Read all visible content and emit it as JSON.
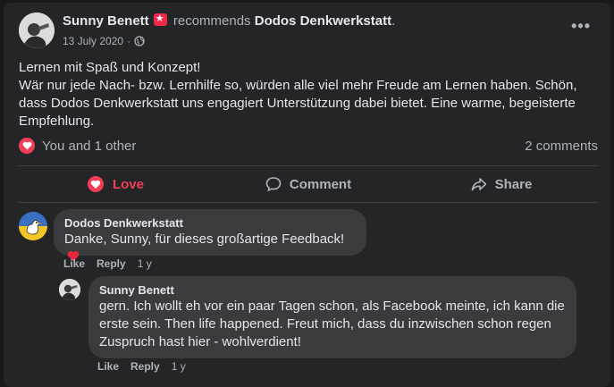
{
  "post": {
    "author": "Sunny Benett",
    "verb": "recommends",
    "page": "Dodos Denkwerkstatt",
    "period": ".",
    "date": "13 July 2020",
    "separator": "·",
    "text_lines": [
      "Lernen mit Spaß und Konzept!",
      "Wär nur jede Nach- bzw. Lernhilfe so, würden alle viel mehr Freude am Lernen haben. Schön, dass Dodos Denkwerkstatt uns engagiert Unterstützung dabei bietet. Eine warme, begeisterte Empfehlung."
    ]
  },
  "reactions": {
    "summary": "You and 1 other",
    "comments_count": "2 comments"
  },
  "actions": {
    "love": "Love",
    "comment": "Comment",
    "share": "Share"
  },
  "comments": [
    {
      "author": "Dodos Denkwerkstatt",
      "text": "Danke, Sunny, für dieses großartige Feedback!",
      "like": "Like",
      "reply": "Reply",
      "time": "1 y"
    },
    {
      "author": "Sunny Benett",
      "text": "gern. Ich wollt eh vor ein paar Tagen schon, als Facebook meinte, ich kann die erste sein. Then life happened. Freut mich, dass du inzwischen schon regen Zuspruch hast hier - wohlverdient!",
      "like": "Like",
      "reply": "Reply",
      "time": "1 y"
    }
  ],
  "icons": {
    "heart": "heart-icon",
    "globe": "globe-icon",
    "more": "more-options-icon",
    "comment": "comment-icon",
    "share": "share-icon"
  },
  "colors": {
    "love": "#f33e58",
    "background": "#242526",
    "bubble": "#3a3b3c"
  }
}
